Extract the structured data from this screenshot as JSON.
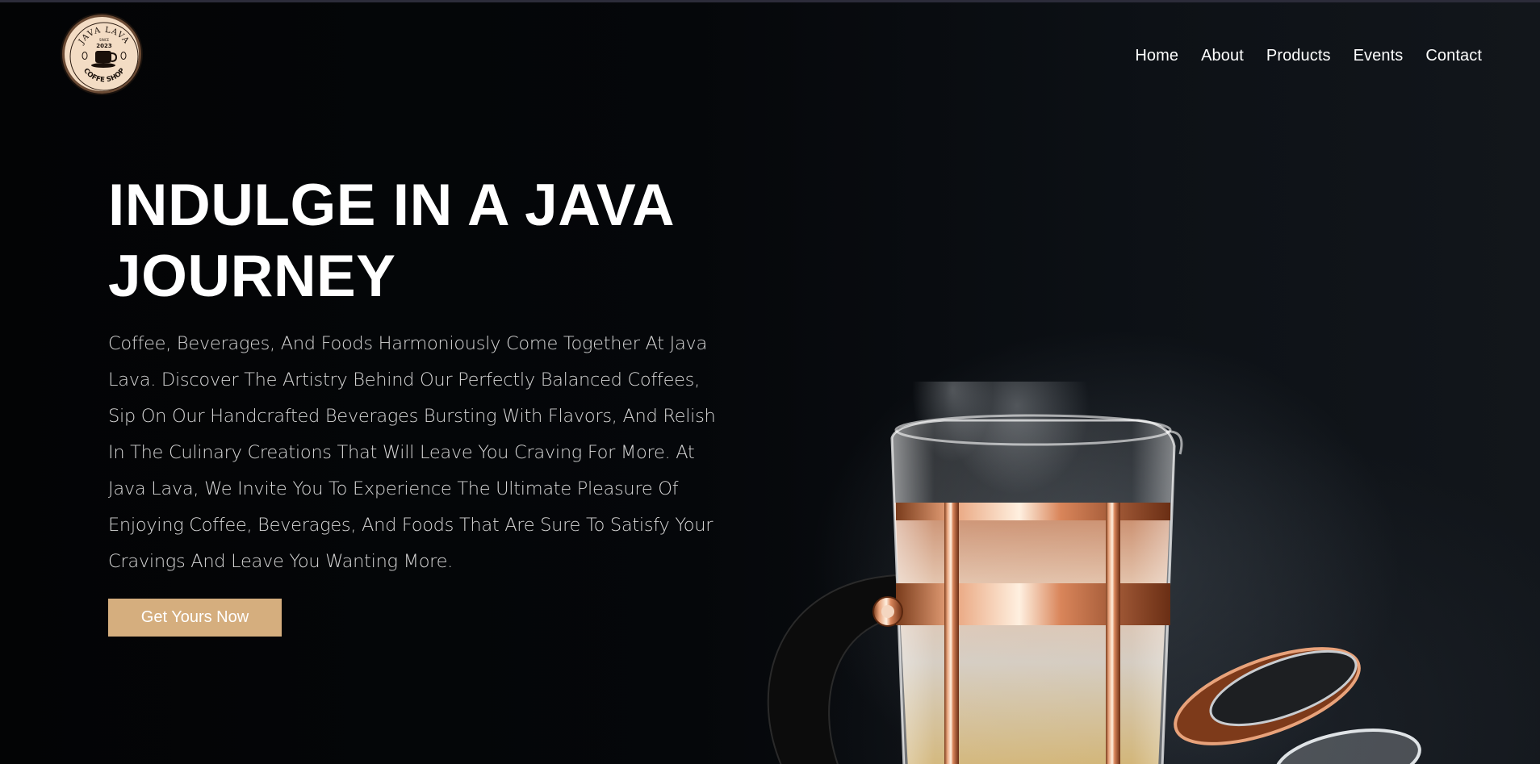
{
  "header": {
    "logo": {
      "text_top": "JAVA LAVA",
      "since": "SINCE",
      "year": "2023",
      "text_bottom": "COFFE SHOP",
      "icon": "coffee-cup-icon"
    },
    "nav": [
      {
        "label": "Home"
      },
      {
        "label": "About"
      },
      {
        "label": "Products"
      },
      {
        "label": "Events"
      },
      {
        "label": "Contact"
      }
    ]
  },
  "hero": {
    "title": "INDULGE IN A JAVA JOURNEY",
    "description": "Coffee, Beverages, And Foods Harmoniously Come Together At Java Lava. Discover The Artistry Behind Our Perfectly Balanced Coffees, Sip On Our Handcrafted Beverages Bursting With Flavors, And Relish In The Culinary Creations That Will Leave You Craving For More. At Java Lava, We Invite You To Experience The Ultimate Pleasure Of Enjoying Coffee, Beverages, And Foods That Are Sure To Satisfy Your Cravings And Leave You Wanting More.",
    "cta_label": "Get Yours Now",
    "image": "french-press-coffee-photo"
  },
  "colors": {
    "accent": "#d5ae7e",
    "background": "#050608",
    "logo_bg": "#f3dcc4"
  }
}
